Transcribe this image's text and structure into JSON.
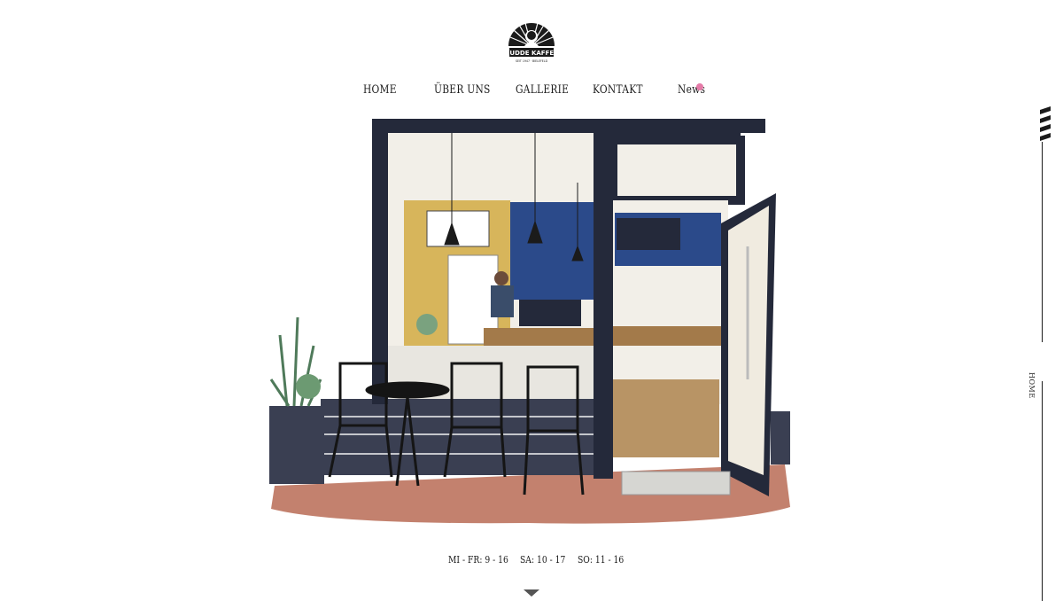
{
  "brand": {
    "logo_text": "BUDDE KAFFEE",
    "logo_subtext": "SEIT 1947 · BIELEFELD"
  },
  "nav": {
    "items": [
      {
        "label": "HOME"
      },
      {
        "label": "ÜBER UNS"
      },
      {
        "label": "GALLERIE"
      },
      {
        "label": "KONTAKT"
      },
      {
        "label": "News"
      }
    ],
    "news_dot_color": "#e57ba8"
  },
  "hours": [
    {
      "text": "MI - FR: 9 - 16"
    },
    {
      "text": "SA: 10 - 17"
    },
    {
      "text": "SO: 11 - 16"
    }
  ],
  "side_nav": {
    "label": "HOME"
  },
  "icons": {
    "scroll": "chevron-down-icon",
    "logo": "sunburst-logo-icon"
  },
  "colors": {
    "frame": "#24293a",
    "wall_yellow": "#d7b55b",
    "wall_blue": "#2b4a8a",
    "floor": "#b86b55",
    "wood": "#a37a4a"
  }
}
